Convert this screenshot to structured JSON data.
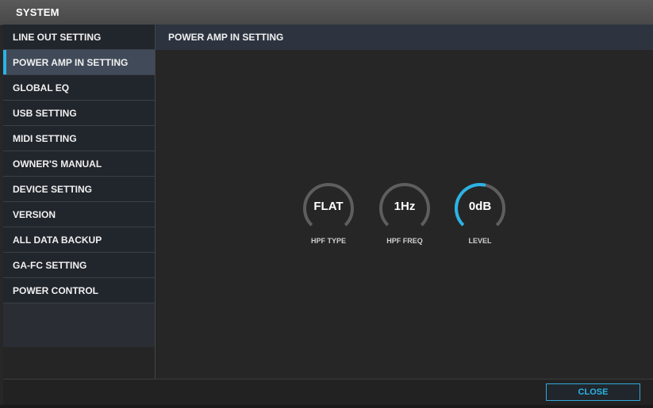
{
  "window": {
    "title": "SYSTEM"
  },
  "sidebar": {
    "active_index": 1,
    "items": [
      {
        "label": "LINE OUT SETTING"
      },
      {
        "label": "POWER AMP IN SETTING"
      },
      {
        "label": "GLOBAL EQ"
      },
      {
        "label": "USB SETTING"
      },
      {
        "label": "MIDI SETTING"
      },
      {
        "label": "OWNER'S MANUAL"
      },
      {
        "label": "DEVICE SETTING"
      },
      {
        "label": "VERSION"
      },
      {
        "label": "ALL DATA BACKUP"
      },
      {
        "label": "GA-FC SETTING"
      },
      {
        "label": "POWER CONTROL"
      }
    ]
  },
  "content": {
    "header": "POWER AMP IN SETTING",
    "knobs": [
      {
        "value": "FLAT",
        "caption": "HPF TYPE",
        "level_fraction": 0.0
      },
      {
        "value": "1Hz",
        "caption": "HPF FREQ",
        "level_fraction": 0.0
      },
      {
        "value": "0dB",
        "caption": "LEVEL",
        "level_fraction": 0.55
      }
    ]
  },
  "footer": {
    "close_label": "CLOSE"
  },
  "colors": {
    "accent": "#2bb3e6",
    "track": "#5e5e5e",
    "active_item_bg": "#404a58",
    "header_bg": "#2d3440"
  }
}
